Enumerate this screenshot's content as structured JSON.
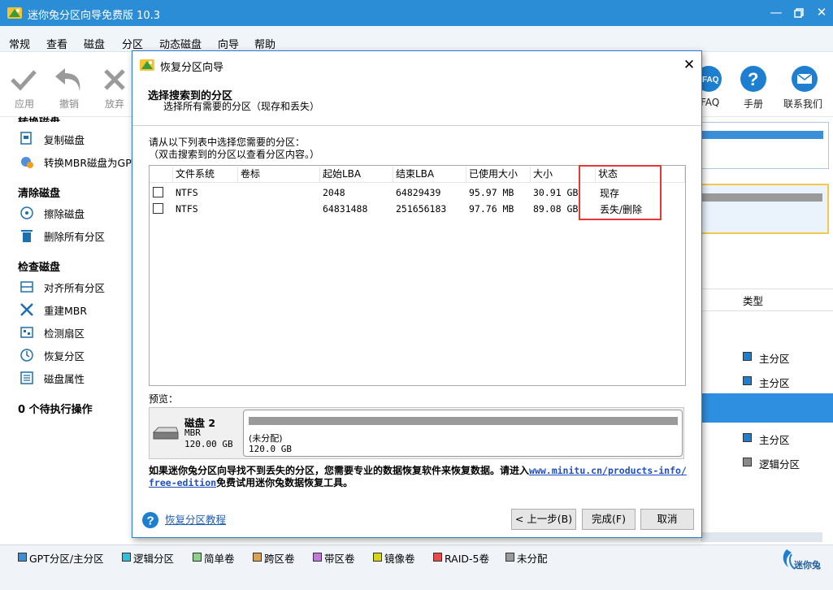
{
  "app": {
    "title": "迷你兔分区向导免费版 10.3"
  },
  "menu": [
    "常规",
    "查看",
    "磁盘",
    "分区",
    "动态磁盘",
    "向导",
    "帮助"
  ],
  "toolbar": {
    "apply": "应用",
    "undo": "撤销",
    "discard": "放弃",
    "faq": "FAQ",
    "manual": "手册",
    "contact": "联系我们"
  },
  "sidebar": {
    "convert_head": "转换磁盘",
    "copy_disk": "复制磁盘",
    "convert_mbr": "转换MBR磁盘为GPT",
    "clean_head": "清除磁盘",
    "wipe_disk": "擦除磁盘",
    "delete_all": "删除所有分区",
    "check_head": "检查磁盘",
    "align_all": "对齐所有分区",
    "rebuild_mbr": "重建MBR",
    "surface_test": "检测扇区",
    "recover_partition": "恢复分区",
    "disk_props": "磁盘属性",
    "pending": "0 个待执行操作"
  },
  "right": {
    "type_header": "类型",
    "rows": [
      "主分区",
      "主分区",
      "主分区",
      "逻辑分区"
    ],
    "row_colors": [
      "#1e7fd0",
      "#1e7fd0",
      "#1e7fd0",
      "#8a8a8a"
    ]
  },
  "legend": [
    {
      "label": "GPT分区/主分区",
      "color": "#3b8fd9"
    },
    {
      "label": "逻辑分区",
      "color": "#2fc0e0"
    },
    {
      "label": "简单卷",
      "color": "#8fcf8a"
    },
    {
      "label": "跨区卷",
      "color": "#d9a256"
    },
    {
      "label": "带区卷",
      "color": "#c07ad8"
    },
    {
      "label": "镜像卷",
      "color": "#d7d21c"
    },
    {
      "label": "RAID-5卷",
      "color": "#e84b4b"
    },
    {
      "label": "未分配",
      "color": "#9a9a9a"
    }
  ],
  "brand": "迷你兔",
  "dialog": {
    "title": "恢复分区向导",
    "heading": "选择搜索到的分区",
    "subheading": "选择所有需要的分区（现存和丢失）",
    "instruction1": "请从以下列表中选择您需要的分区：",
    "instruction2": "（双击搜索到的分区以查看分区内容。）",
    "columns": [
      "文件系统",
      "卷标",
      "起始LBA",
      "结束LBA",
      "已使用大小",
      "大小",
      "状态"
    ],
    "rows": [
      {
        "fs": "NTFS",
        "label": "",
        "start": "2048",
        "end": "64829439",
        "used": "95.97 MB",
        "size": "30.91 GB",
        "status": "现存"
      },
      {
        "fs": "NTFS",
        "label": "",
        "start": "64831488",
        "end": "251656183",
        "used": "97.76 MB",
        "size": "89.08 GB",
        "status": "丢失/删除"
      }
    ],
    "preview_label": "预览：",
    "disk_name": "磁盘 2",
    "disk_type": "MBR",
    "disk_size": "120.00 GB",
    "unalloc_label": "(未分配)",
    "unalloc_size": "120.0 GB",
    "notice_pre": "如果迷你兔分区向导找不到丢失的分区，您需要专业的数据恢复软件来恢复数据。请进入",
    "notice_link": "www.minitu.cn/products-info/free-edition",
    "notice_post": "免费试用迷你兔数据恢复工具。",
    "tutorial_link": "恢复分区教程",
    "back_button": "< 上一步(B)",
    "finish_button": "完成(F)",
    "cancel_button": "取消"
  }
}
